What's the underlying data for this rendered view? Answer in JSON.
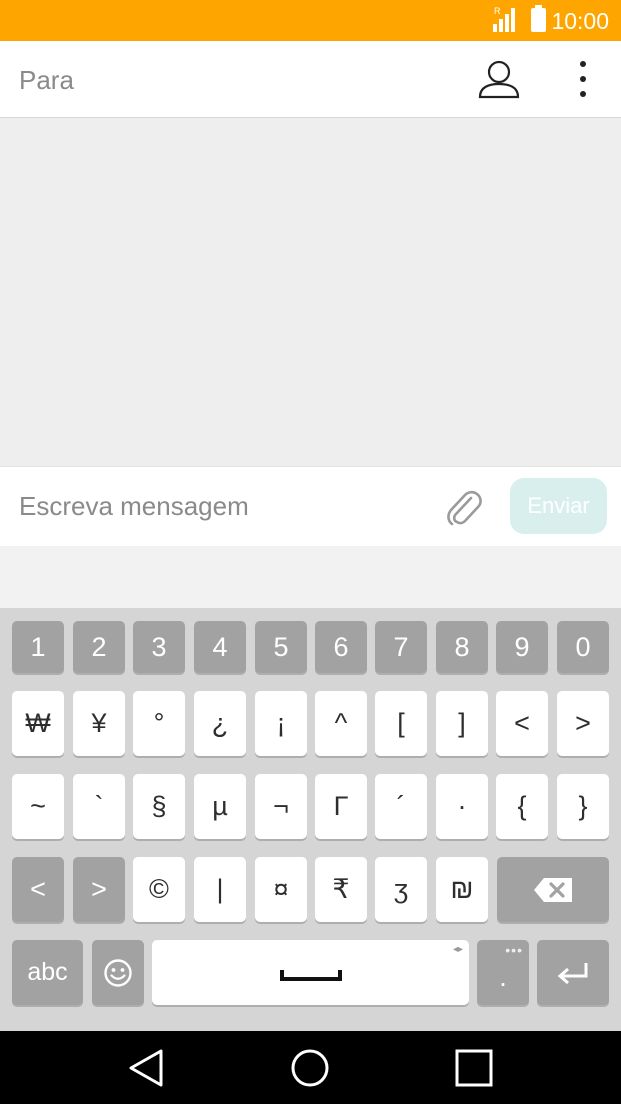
{
  "status_bar": {
    "time": "10:00",
    "roaming": "R",
    "colors": {
      "background": "#FFA500"
    }
  },
  "header": {
    "to_placeholder": "Para",
    "contact_icon": "person-icon",
    "menu_icon": "more-vert-icon"
  },
  "compose": {
    "placeholder": "Escreva mensagem",
    "send_label": "Enviar",
    "attach_icon": "paperclip-icon"
  },
  "keyboard": {
    "row1": [
      "1",
      "2",
      "3",
      "4",
      "5",
      "6",
      "7",
      "8",
      "9",
      "0"
    ],
    "row2": [
      "₩",
      "¥",
      "°",
      "¿",
      "¡",
      "^",
      "[",
      "]",
      "<",
      ">"
    ],
    "row3": [
      "~",
      "`",
      "§",
      "µ",
      "¬",
      "Γ",
      "´",
      "·",
      "{",
      "}"
    ],
    "row4": [
      "<",
      ">",
      "©",
      "|",
      "¤",
      "₹",
      "ʒ",
      "₪"
    ],
    "abc_label": "abc",
    "period_label": ".",
    "arrows_hint": "◂▸",
    "dots_hint": "•••"
  },
  "nav": {
    "back_icon": "back-triangle-icon",
    "home_icon": "home-circle-icon",
    "recents_icon": "recents-square-icon"
  }
}
